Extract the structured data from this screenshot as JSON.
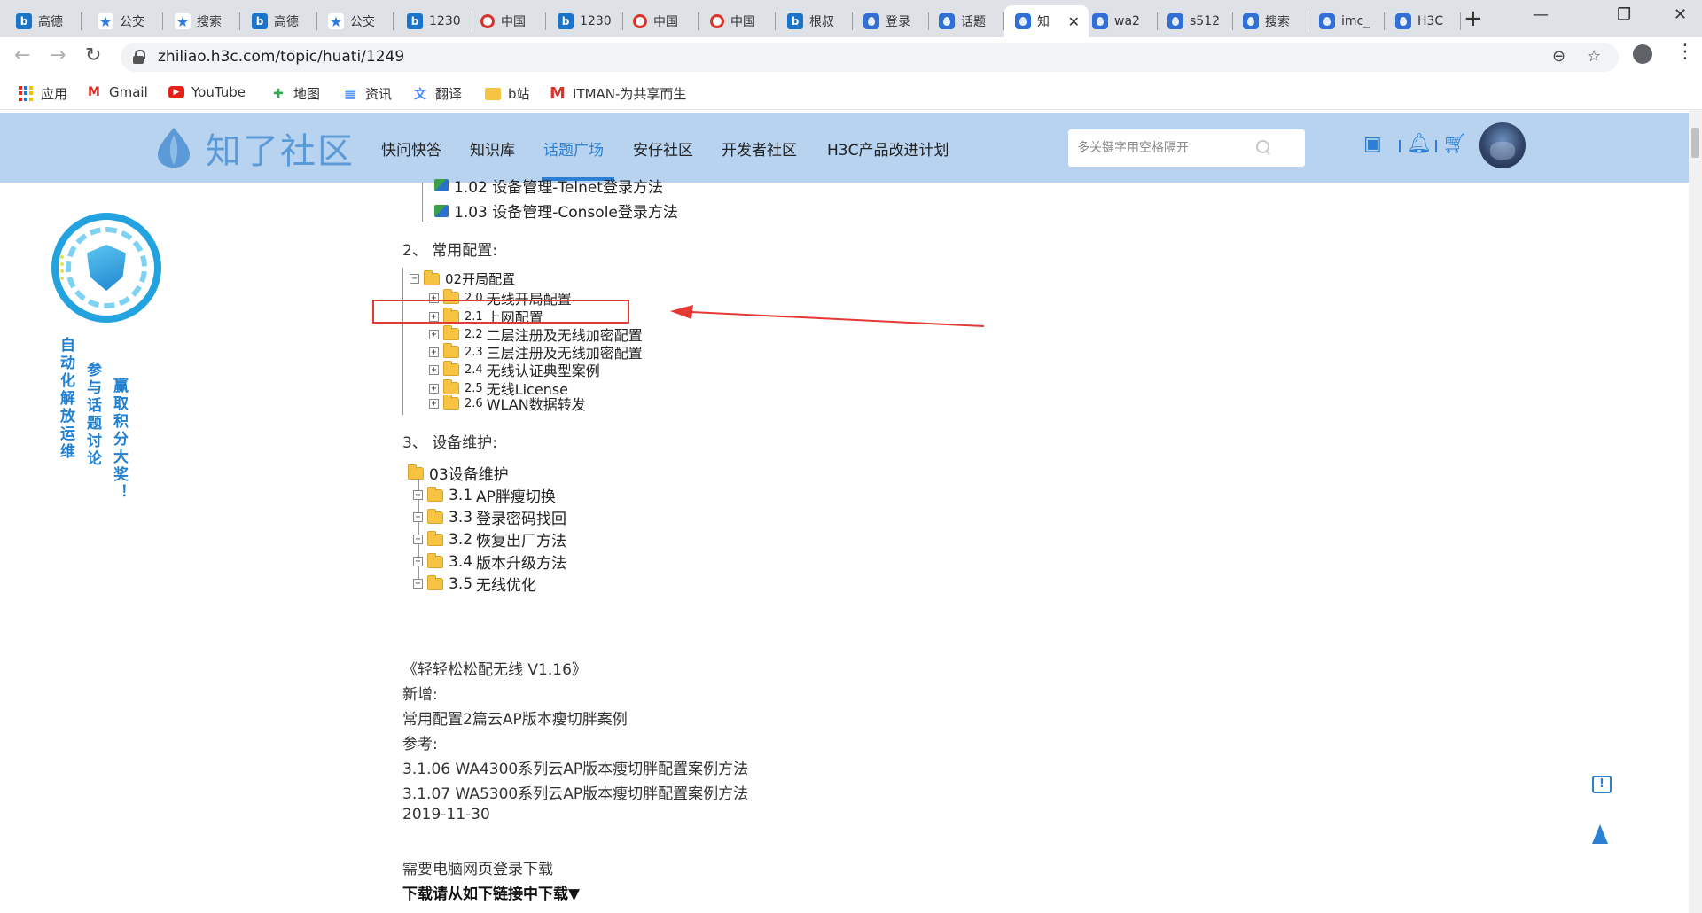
{
  "browser": {
    "tabs": [
      {
        "label": "高德",
        "icon": "b"
      },
      {
        "label": "公交",
        "icon": "star"
      },
      {
        "label": "搜索",
        "icon": "star"
      },
      {
        "label": "高德",
        "icon": "b"
      },
      {
        "label": "公交",
        "icon": "star"
      },
      {
        "label": "1230",
        "icon": "b"
      },
      {
        "label": "中国",
        "icon": "red"
      },
      {
        "label": "1230",
        "icon": "b"
      },
      {
        "label": "中国",
        "icon": "red"
      },
      {
        "label": "中国",
        "icon": "red"
      },
      {
        "label": "根叔",
        "icon": "b"
      },
      {
        "label": "登录",
        "icon": "drop"
      },
      {
        "label": "话题",
        "icon": "drop"
      },
      {
        "label": "知",
        "icon": "drop"
      },
      {
        "label": "wa2",
        "icon": "drop"
      },
      {
        "label": "s512",
        "icon": "drop"
      },
      {
        "label": "搜索",
        "icon": "drop"
      },
      {
        "label": "imc_",
        "icon": "drop"
      },
      {
        "label": "H3C",
        "icon": "drop"
      }
    ],
    "active_tab_index": 13,
    "url": "zhiliao.h3c.com/topic/huati/1249",
    "bookmarks": [
      {
        "label": "应用",
        "icon": "apps-icon"
      },
      {
        "label": "Gmail",
        "icon": "gmail-icon"
      },
      {
        "label": "YouTube",
        "icon": "youtube-icon"
      },
      {
        "label": "地图",
        "icon": "maps-icon"
      },
      {
        "label": "资讯",
        "icon": "news-icon"
      },
      {
        "label": "翻译",
        "icon": "translate-icon"
      },
      {
        "label": "b站",
        "icon": "folder-icon"
      },
      {
        "label": "ITMAN-为共享而生",
        "icon": "itman-icon"
      }
    ]
  },
  "site": {
    "logo_text": "知了社区",
    "nav": [
      "快问快答",
      "知识库",
      "话题广场",
      "安仔社区",
      "开发者社区",
      "H3C产品改进计划"
    ],
    "active_nav_index": 2,
    "search_placeholder": "多关键字用空格隔开",
    "accent_color": "#2b7fd4",
    "header_bg": "#b7d3ef"
  },
  "promo": {
    "col1": "自动化解放运维",
    "col2": "参与话题讨论",
    "col3": "赢取积分大奖！"
  },
  "content": {
    "top_items": [
      "1.02 设备管理-Telnet登录方法",
      "1.03 设备管理-Console登录方法"
    ],
    "section2_title": "2、 常用配置:",
    "section2_root": "02开局配置",
    "section2_items": [
      {
        "num": "2.0",
        "text": "无线开局配置"
      },
      {
        "num": "2.1",
        "text": "上网配置"
      },
      {
        "num": "2.2",
        "text": "二层注册及无线加密配置"
      },
      {
        "num": "2.3",
        "text": "三层注册及无线加密配置"
      },
      {
        "num": "2.4",
        "text": "无线认证典型案例"
      },
      {
        "num": "2.5",
        "text": "无线License"
      },
      {
        "num": "2.6",
        "text": "WLAN数据转发"
      }
    ],
    "section3_title": "3、 设备维护:",
    "section3_root": "03设备维护",
    "section3_items": [
      {
        "num": "3.1",
        "text": "AP胖瘦切换"
      },
      {
        "num": "3.3",
        "text": "登录密码找回"
      },
      {
        "num": "3.2",
        "text": "恢复出厂方法"
      },
      {
        "num": "3.4",
        "text": "版本升级方法"
      },
      {
        "num": "3.5",
        "text": "无线优化"
      }
    ],
    "paragraphs": [
      "《轻轻松松配无线 V1.16》",
      "新增:",
      "常用配置2篇云AP版本瘦切胖案例",
      "参考:",
      "3.1.06 WA4300系列云AP版本瘦切胖配置案例方法",
      "3.1.07 WA5300系列云AP版本瘦切胖配置案例方法",
      "2019-11-30"
    ],
    "login_note": "需要电脑网页登录下载",
    "download_note": "下载请从如下链接中下载▼"
  }
}
